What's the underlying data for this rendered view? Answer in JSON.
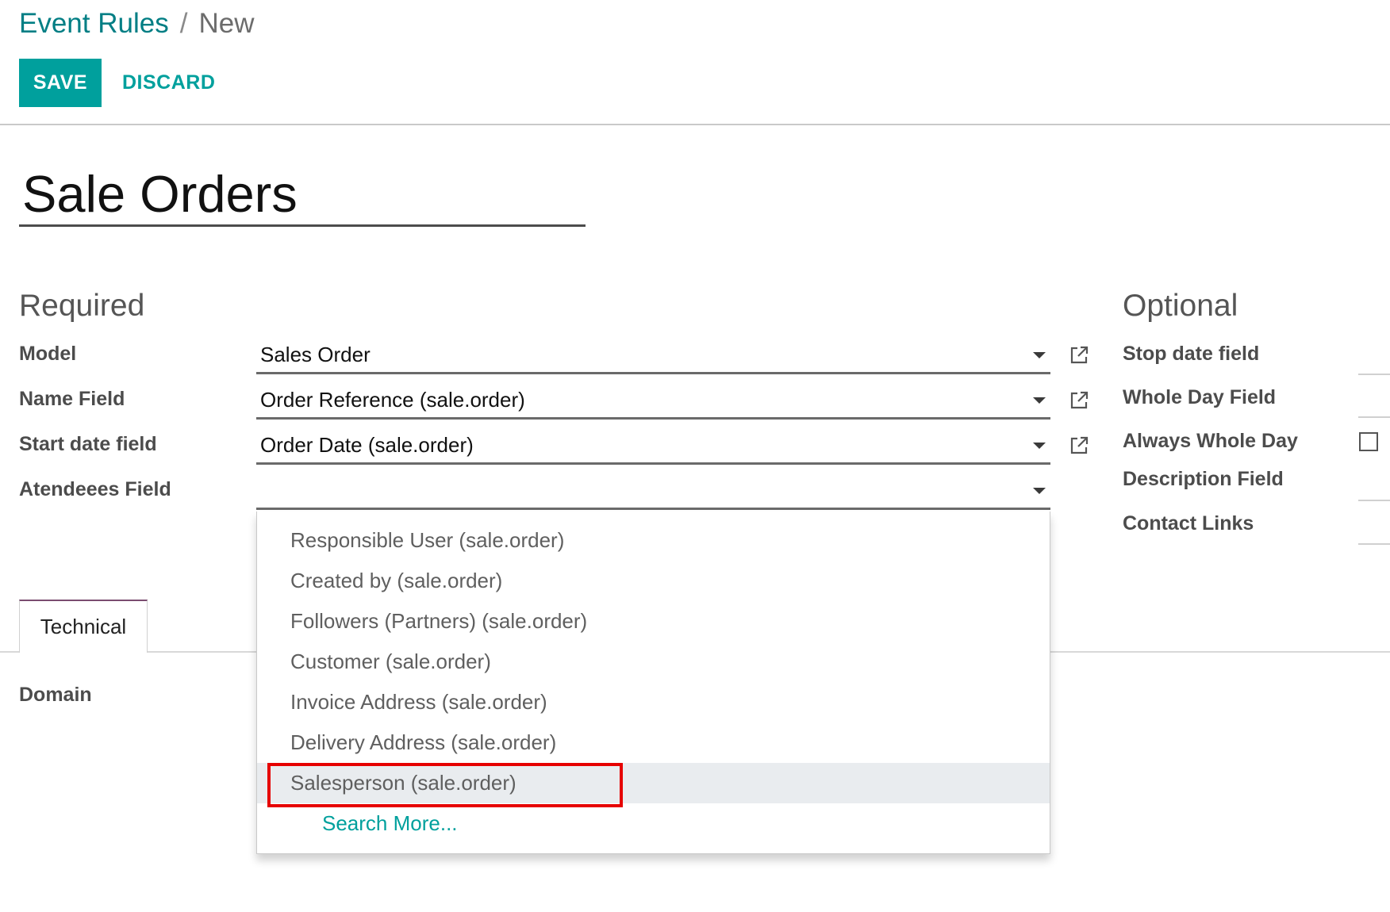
{
  "breadcrumb": {
    "parent": "Event Rules",
    "separator": "/",
    "current": "New"
  },
  "toolbar": {
    "save_label": "SAVE",
    "discard_label": "DISCARD"
  },
  "record": {
    "name": "Sale Orders"
  },
  "required": {
    "title": "Required",
    "fields": [
      {
        "label": "Model",
        "value": "Sales Order"
      },
      {
        "label": "Name Field",
        "value": "Order Reference (sale.order)"
      },
      {
        "label": "Start date field",
        "value": "Order Date (sale.order)"
      },
      {
        "label": "Atendeees Field",
        "value": ""
      }
    ]
  },
  "optional": {
    "title": "Optional",
    "fields": [
      {
        "label": "Stop date field"
      },
      {
        "label": "Whole Day Field"
      },
      {
        "label": "Always Whole Day",
        "checked": false
      },
      {
        "label": "Description Field"
      },
      {
        "label": "Contact Links"
      }
    ]
  },
  "notebook": {
    "tabs": [
      {
        "label": "Technical",
        "active": true
      }
    ],
    "domain_label": "Domain"
  },
  "dropdown": {
    "items": [
      "Responsible User (sale.order)",
      "Created by (sale.order)",
      "Followers (Partners) (sale.order)",
      "Customer (sale.order)",
      "Invoice Address (sale.order)",
      "Delivery Address (sale.order)",
      "Salesperson (sale.order)"
    ],
    "highlighted_index": 6,
    "search_more": "Search More..."
  },
  "icons": {
    "external_link": "external-link-icon",
    "caret": "caret-down-icon"
  },
  "colors": {
    "accent": "#00a09d",
    "breadcrumb_link": "#017e84",
    "highlight_border": "#e60000",
    "active_item_bg": "#e9ecef"
  }
}
